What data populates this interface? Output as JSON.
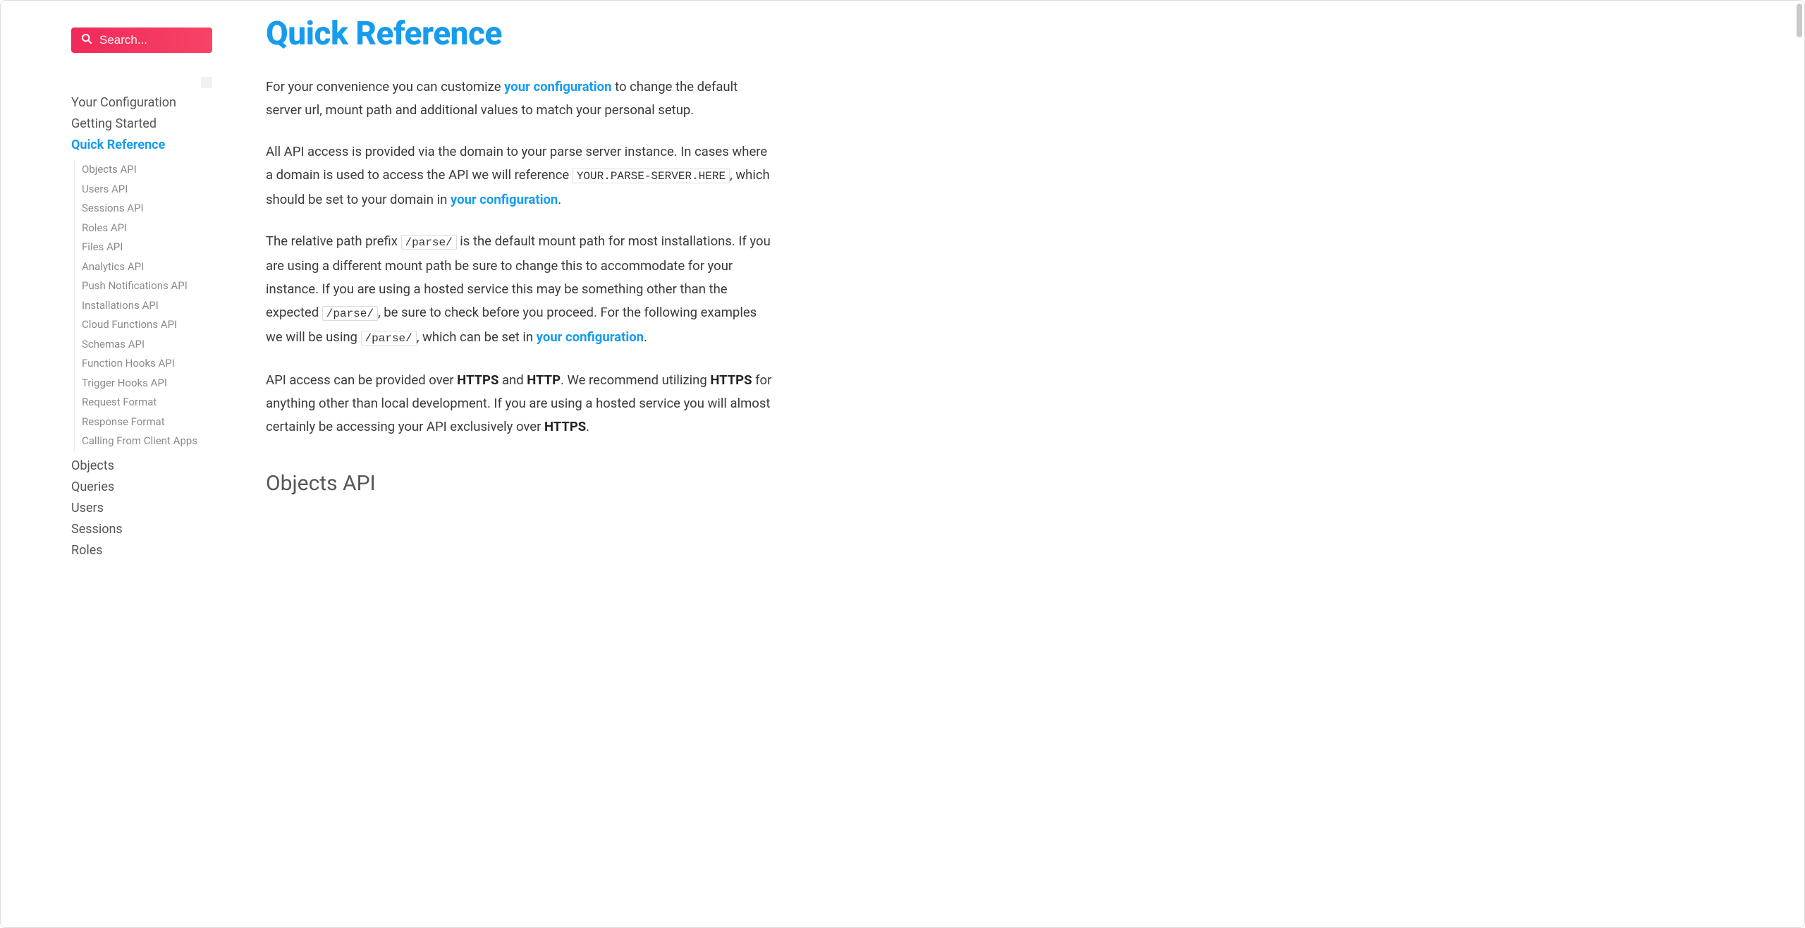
{
  "colors": {
    "accent": "#169cee",
    "search_bg": "#f42a58"
  },
  "search": {
    "placeholder": "Search..."
  },
  "nav": {
    "top": [
      {
        "label": "Your Configuration",
        "active": false
      },
      {
        "label": "Getting Started",
        "active": false
      },
      {
        "label": "Quick Reference",
        "active": true
      },
      {
        "label": "Objects",
        "active": false
      },
      {
        "label": "Queries",
        "active": false
      },
      {
        "label": "Users",
        "active": false
      },
      {
        "label": "Sessions",
        "active": false
      },
      {
        "label": "Roles",
        "active": false
      }
    ],
    "quick_reference_children": [
      "Objects API",
      "Users API",
      "Sessions API",
      "Roles API",
      "Files API",
      "Analytics API",
      "Push Notifications API",
      "Installations API",
      "Cloud Functions API",
      "Schemas API",
      "Function Hooks API",
      "Trigger Hooks API",
      "Request Format",
      "Response Format",
      "Calling From Client Apps"
    ]
  },
  "page": {
    "title": "Quick Reference",
    "p1_pre": "For your convenience you can customize ",
    "p1_link": "your configuration",
    "p1_post": " to change the default server url, mount path and additional values to match your personal setup.",
    "p2_pre": "All API access is provided via the domain to your parse server instance. In cases where a domain is used to access the API we will reference ",
    "p2_code": "YOUR.PARSE-SERVER.HERE",
    "p2_mid": ", which should be set to your domain in ",
    "p2_link": "your configuration",
    "p2_post": ".",
    "p3_pre": "The relative path prefix ",
    "p3_code1": "/parse/",
    "p3_mid1": " is the default mount path for most installations. If you are using a different mount path be sure to change this to accommodate for your instance. If you are using a hosted service this may be something other than the expected ",
    "p3_code2": "/parse/",
    "p3_mid2": ", be sure to check before you proceed. For the following examples we will be using ",
    "p3_code3": "/parse/",
    "p3_mid3": ", which can be set in ",
    "p3_link": "your configuration",
    "p3_post": ".",
    "p4_pre": "API access can be provided over ",
    "p4_b1": "HTTPS",
    "p4_mid1": " and ",
    "p4_b2": "HTTP",
    "p4_mid2": ". We recommend utilizing ",
    "p4_b3": "HTTPS",
    "p4_mid3": " for anything other than local development. If you are using a hosted service you will almost certainly be accessing your API exclusively over ",
    "p4_b4": "HTTPS",
    "p4_post": ".",
    "section2_title": "Objects API"
  }
}
